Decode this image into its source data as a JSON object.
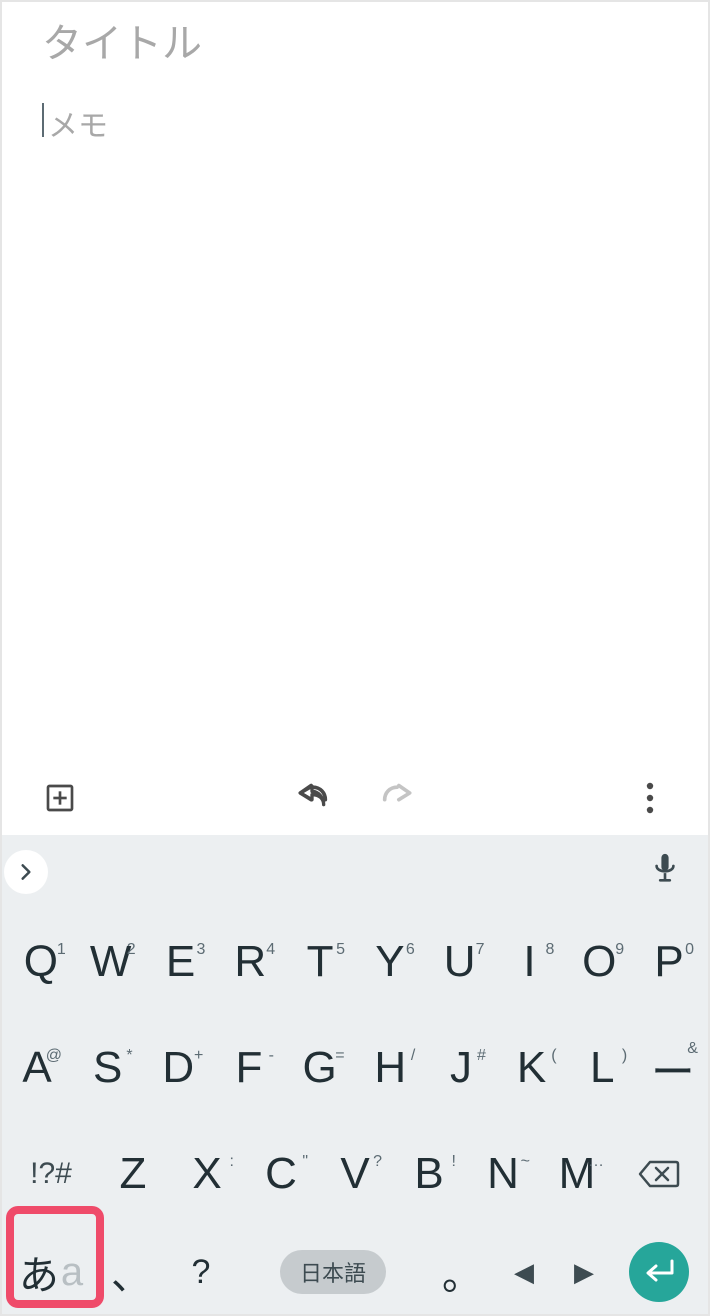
{
  "editor": {
    "title_placeholder": "タイトル",
    "body_placeholder": "メモ",
    "title_value": "",
    "body_value": ""
  },
  "toolbar": {
    "add": "add",
    "undo": "undo",
    "redo": "redo",
    "more": "more"
  },
  "keyboard": {
    "expand_icon": "chevron-right",
    "mic_icon": "mic",
    "row1": [
      {
        "main": "Q",
        "sup": "1"
      },
      {
        "main": "W",
        "sup": "2"
      },
      {
        "main": "E",
        "sup": "3"
      },
      {
        "main": "R",
        "sup": "4"
      },
      {
        "main": "T",
        "sup": "5"
      },
      {
        "main": "Y",
        "sup": "6"
      },
      {
        "main": "U",
        "sup": "7"
      },
      {
        "main": "I",
        "sup": "8"
      },
      {
        "main": "O",
        "sup": "9"
      },
      {
        "main": "P",
        "sup": "0"
      }
    ],
    "row2": [
      {
        "main": "A",
        "sup": "@"
      },
      {
        "main": "S",
        "sup": "*"
      },
      {
        "main": "D",
        "sup": "+"
      },
      {
        "main": "F",
        "sup": "-"
      },
      {
        "main": "G",
        "sup": "="
      },
      {
        "main": "H",
        "sup": "/"
      },
      {
        "main": "J",
        "sup": "#"
      },
      {
        "main": "K",
        "sup": "("
      },
      {
        "main": "L",
        "sup": ")"
      },
      {
        "main": "ー",
        "sup": "&"
      }
    ],
    "row3_left_label": "!?#",
    "row3": [
      {
        "main": "Z",
        "sup": ""
      },
      {
        "main": "X",
        "sup": ":"
      },
      {
        "main": "C",
        "sup": "\""
      },
      {
        "main": "V",
        "sup": "?"
      },
      {
        "main": "B",
        "sup": "!"
      },
      {
        "main": "N",
        "sup": "~"
      },
      {
        "main": "M",
        "sup": "…"
      }
    ],
    "row3_right": "backspace",
    "row4": {
      "lang_active": "あ",
      "lang_inactive": "a",
      "comma": "、",
      "question": "?",
      "space_label": "日本語",
      "period": "。",
      "left_arrow": "◀",
      "right_arrow": "▶",
      "enter": "enter"
    }
  }
}
